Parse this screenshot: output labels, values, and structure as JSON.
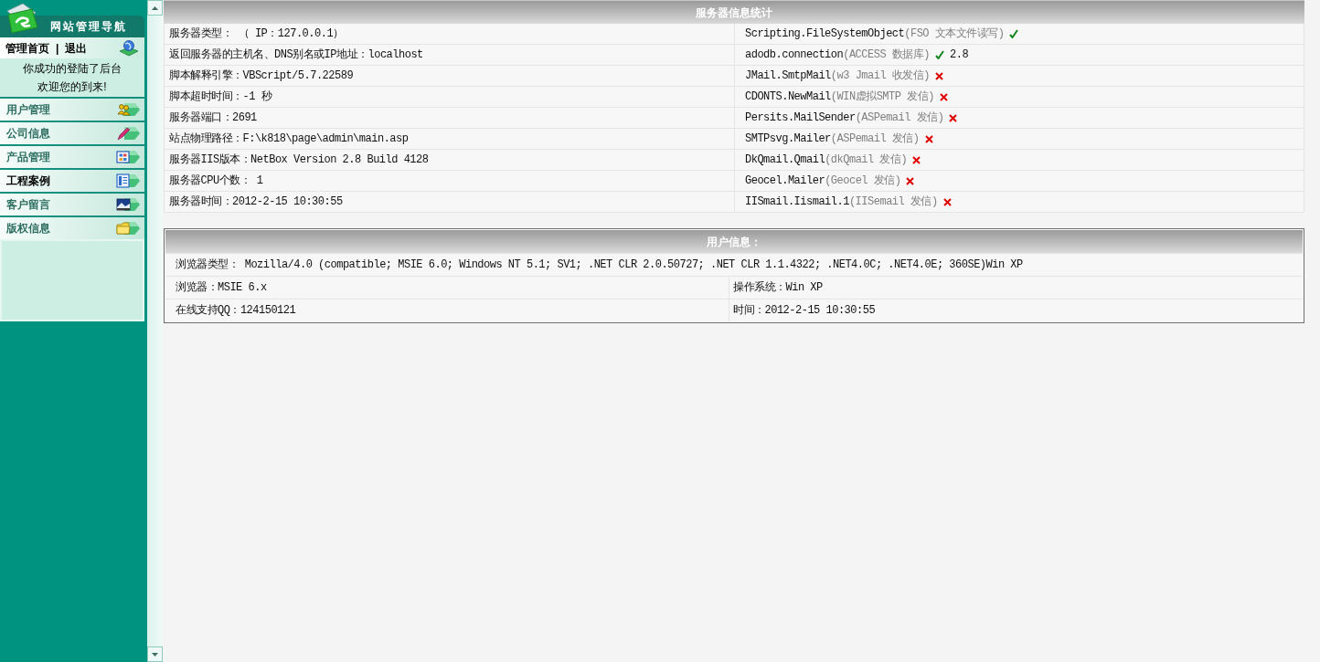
{
  "sidebar": {
    "title": "网站管理导航",
    "home_link": "管理首页",
    "separator": "|",
    "logout_link": "退出",
    "welcome": [
      "你成功的登陆了后台",
      "欢迎您的到来!"
    ],
    "menu": [
      {
        "label": "用户管理",
        "selected": false
      },
      {
        "label": "公司信息",
        "selected": false
      },
      {
        "label": "产品管理",
        "selected": false
      },
      {
        "label": "工程案例",
        "selected": true
      },
      {
        "label": "客户留言",
        "selected": false
      },
      {
        "label": "版权信息",
        "selected": false
      }
    ]
  },
  "server_info": {
    "title": "服务器信息统计",
    "rows": [
      {
        "info": "服务器类型： （ IP：127.0.0.1）",
        "component": {
          "name": "Scripting.FileSystemObject",
          "description": "(FSO 文本文件读写)",
          "supported": true
        }
      },
      {
        "info": "返回服务器的主机名、DNS别名或IP地址：localhost",
        "component": {
          "name": "adodb.connection",
          "description": "(ACCESS 数据库)",
          "supported": true,
          "version": "2.8"
        }
      },
      {
        "info": "脚本解释引擎：VBScript/5.7.22589",
        "component": {
          "name": "JMail.SmtpMail",
          "description": "(w3 Jmail 收发信)",
          "supported": false
        }
      },
      {
        "info": "脚本超时时间：-1 秒",
        "component": {
          "name": "CDONTS.NewMail",
          "description": "(WIN虚拟SMTP 发信)",
          "supported": false
        }
      },
      {
        "info": "服务器端口：2691",
        "component": {
          "name": "Persits.MailSender",
          "description": "(ASPemail 发信)",
          "supported": false
        }
      },
      {
        "info": "站点物理路径：F:\\k818\\page\\admin\\main.asp",
        "component": {
          "name": "SMTPsvg.Mailer",
          "description": "(ASPemail 发信)",
          "supported": false
        }
      },
      {
        "info": "服务器IIS版本：NetBox Version 2.8 Build 4128",
        "component": {
          "name": "DkQmail.Qmail",
          "description": "(dkQmail 发信)",
          "supported": false
        }
      },
      {
        "info": "服务器CPU个数： 1",
        "component": {
          "name": "Geocel.Mailer",
          "description": "(Geocel 发信)",
          "supported": false
        }
      },
      {
        "info": "服务器时间：2012-2-15 10:30:55",
        "component": {
          "name": "IISmail.Iismail.1",
          "description": "(IISemail 发信)",
          "supported": false
        }
      }
    ]
  },
  "user_info": {
    "title": "用户信息：",
    "rows": [
      {
        "cells": [
          "浏览器类型： Mozilla/4.0 (compatible; MSIE 6.0; Windows NT 5.1; SV1; .NET CLR 2.0.50727; .NET CLR 1.1.4322; .NET4.0C; .NET4.0E; 360SE)Win XP"
        ]
      },
      {
        "cells": [
          "浏览器：MSIE 6.x",
          "操作系统：Win XP"
        ]
      },
      {
        "cells": [
          "在线支持QQ：124150121",
          "时间：2012-2-15 10:30:55"
        ]
      }
    ]
  }
}
